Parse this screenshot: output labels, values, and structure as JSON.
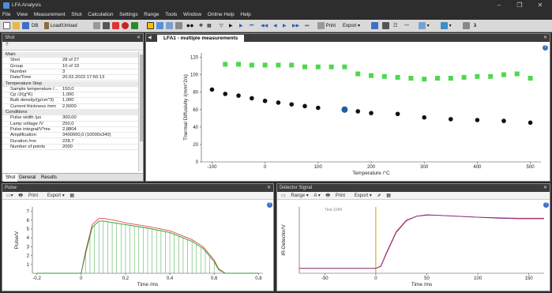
{
  "window": {
    "title": "LFA Analysis",
    "minimize": "–",
    "maximize": "❐",
    "close": "✕"
  },
  "menu": [
    "File",
    "View",
    "Measurement",
    "Shot",
    "Calculation",
    "Settings",
    "Range",
    "Tools",
    "Window",
    "Online Help",
    "Help"
  ],
  "toolbar": {
    "db": "DB",
    "load": "Load/Unload",
    "print": "Print",
    "export": "Export"
  },
  "shot_panel": {
    "title": "Shot",
    "help": "?",
    "sections": [
      {
        "name": "Main",
        "rows": [
          [
            "Shot",
            "28 of 27"
          ],
          [
            "Group",
            "10 of 19"
          ],
          [
            "Number",
            "3"
          ],
          [
            "Date/Time",
            "20.02.2023 17:50:13"
          ]
        ]
      },
      {
        "name": "Temperature Step",
        "rows": [
          [
            "Sample temperature /...",
            "150,0"
          ],
          [
            "Cp /J/(g*K)",
            "1,000"
          ],
          [
            "Bulk density/(g/cm^3)",
            "1,000"
          ],
          [
            "Current thickness /mm",
            "2,5000"
          ]
        ]
      },
      {
        "name": "Conditions",
        "rows": [
          [
            "Pulse width /µs",
            "300,00"
          ],
          [
            "Lamp voltage /V",
            "250,0"
          ],
          [
            "Pulse integral/V*ms",
            "2,8804"
          ],
          [
            "Amplification",
            "3400000,0 (10000x340)"
          ],
          [
            "Duration /ms",
            "228,7"
          ],
          [
            "Number of points",
            "2000"
          ]
        ]
      }
    ],
    "tabs": [
      "Shot",
      "General",
      "Results"
    ]
  },
  "main_chart_panel": {
    "tab": "LFA1 - multiple measurements",
    "help": "?"
  },
  "pulse_panel": {
    "title": "Pulse",
    "range": "",
    "print": "Print",
    "export": "Export",
    "help": "?"
  },
  "detector_panel": {
    "title": "Detector Signal",
    "range": "Range",
    "print": "Print",
    "export": "Export",
    "help": "?",
    "annotation": "Test-1049"
  },
  "chart_data": [
    {
      "type": "scatter",
      "xlabel": "Temperature /°C",
      "ylabel": "Thermal Diffusivity /(mm^2/s)",
      "xlim": [
        -120,
        520
      ],
      "ylim": [
        0,
        125
      ],
      "xticks": [
        -100,
        0,
        100,
        200,
        300,
        400,
        500
      ],
      "yticks": [
        0,
        20,
        40,
        60,
        80,
        100,
        120
      ],
      "series": [
        {
          "color": "#4cd94c",
          "marker": "square",
          "x": [
            -75,
            -50,
            -25,
            0,
            25,
            50,
            75,
            100,
            125,
            150,
            175,
            200,
            225,
            250,
            275,
            300,
            325,
            350,
            375,
            400,
            425,
            450,
            475,
            500
          ],
          "y": [
            112,
            112,
            111,
            111,
            111,
            111,
            109,
            109,
            109,
            109,
            101,
            99,
            98,
            97,
            96,
            95,
            96,
            96,
            97,
            98,
            98,
            100,
            101,
            96
          ]
        },
        {
          "color": "#111111",
          "marker": "circle",
          "x": [
            -100,
            -75,
            -50,
            -25,
            0,
            25,
            50,
            75,
            100,
            150,
            175,
            200,
            250,
            300,
            350,
            400,
            450,
            500
          ],
          "y": [
            83,
            78,
            76,
            73,
            70,
            68,
            66,
            64,
            62,
            59,
            58,
            56,
            55,
            51,
            49,
            48,
            47,
            45
          ]
        },
        {
          "color": "#1f5f9f",
          "marker": "circle",
          "x": [
            150
          ],
          "y": [
            60
          ]
        }
      ]
    },
    {
      "type": "line",
      "xlabel": "Time /ms",
      "ylabel": "Pulse/V",
      "xlim": [
        -0.22,
        0.82
      ],
      "ylim": [
        0,
        7.5
      ],
      "xticks": [
        -0.2,
        0,
        0.2,
        0.4,
        0.6,
        0.8
      ],
      "xtick_labels": [
        "-0,2",
        "0",
        "0,2",
        "0,4",
        "0,6",
        "0,8"
      ],
      "yticks": [
        1,
        2,
        3,
        4,
        5,
        6,
        7
      ],
      "series": [
        {
          "color": "#e24b4b",
          "x": [
            -0.2,
            0.0,
            0.02,
            0.05,
            0.08,
            0.1,
            0.15,
            0.2,
            0.3,
            0.4,
            0.5,
            0.55,
            0.6,
            0.62,
            0.65,
            0.8
          ],
          "y": [
            0,
            0,
            2.5,
            5.5,
            6.2,
            6.2,
            6.0,
            5.7,
            5.3,
            4.8,
            3.8,
            3.0,
            1.5,
            0.5,
            0,
            0
          ]
        },
        {
          "color": "#2e9a2e",
          "x": [
            -0.2,
            0.0,
            0.02,
            0.05,
            0.08,
            0.1,
            0.15,
            0.2,
            0.3,
            0.4,
            0.5,
            0.55,
            0.6,
            0.62,
            0.65,
            0.8
          ],
          "y": [
            0,
            0,
            2.2,
            5.2,
            5.9,
            5.9,
            5.7,
            5.5,
            5.1,
            4.6,
            3.6,
            2.8,
            1.3,
            0.4,
            0,
            0
          ]
        }
      ]
    },
    {
      "type": "line",
      "xlabel": "Time /ms",
      "ylabel": "IR-Detector/V",
      "xlim": [
        -75,
        165
      ],
      "ylim": [
        -0.1,
        1.25
      ],
      "xticks": [
        -50,
        0,
        50,
        100,
        150
      ],
      "xtick_labels": [
        "-50",
        "0",
        "50",
        "100",
        "150"
      ],
      "series": [
        {
          "color": "#e24b4b",
          "x": [
            -75,
            0,
            5,
            10,
            20,
            30,
            40,
            50,
            60,
            70,
            80,
            100,
            120,
            140,
            165
          ],
          "y": [
            0,
            0,
            0.05,
            0.3,
            0.75,
            0.98,
            1.06,
            1.08,
            1.08,
            1.07,
            1.06,
            1.04,
            1.03,
            1.02,
            1.02
          ]
        },
        {
          "color": "#7a2a8a",
          "x": [
            -75,
            0,
            5,
            10,
            20,
            30,
            40,
            50,
            60,
            70,
            80,
            100,
            120,
            140,
            165
          ],
          "y": [
            0,
            0,
            0.04,
            0.28,
            0.73,
            0.97,
            1.06,
            1.09,
            1.08,
            1.07,
            1.06,
            1.04,
            1.02,
            1.01,
            1.01
          ]
        }
      ]
    }
  ]
}
